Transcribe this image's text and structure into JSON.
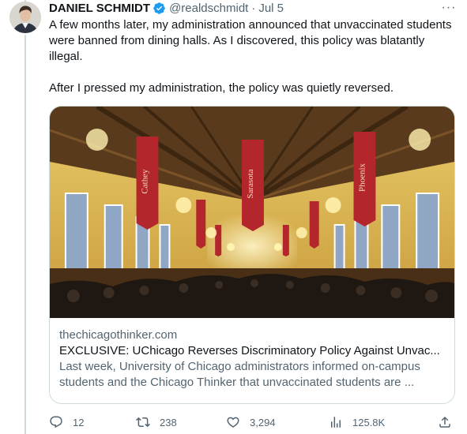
{
  "tweet": {
    "author_name": "DANIEL SCHMIDT",
    "handle": "@realdschmidt",
    "separator": "·",
    "date": "Jul 5",
    "more_label": "···",
    "paragraphs": [
      "A few months later, my administration announced that unvaccinated students were banned from dining halls. As I discovered, this policy was blatantly illegal.",
      "After I pressed my administration, the policy was quietly reversed."
    ]
  },
  "card": {
    "domain": "thechicagothinker.com",
    "title": "EXCLUSIVE: UChicago Reverses Discriminatory Policy Against Unvac...",
    "description": "Last week, University of Chicago administrators informed on-campus students and the Chicago Thinker that unvaccinated students are ...",
    "banners": [
      "Cathey",
      "Sarasota",
      "Phoenix"
    ]
  },
  "actions": {
    "replies": "12",
    "retweets": "238",
    "likes": "3,294",
    "views": "125.8K"
  },
  "icons": {
    "verified": "verified-badge-icon",
    "reply": "reply-icon",
    "retweet": "retweet-icon",
    "like": "heart-icon",
    "views": "views-chart-icon",
    "share": "share-icon"
  },
  "colors": {
    "verified_blue": "#1d9bf0",
    "text_primary": "#0f1419",
    "text_secondary": "#536471",
    "border": "#cfd9de"
  }
}
